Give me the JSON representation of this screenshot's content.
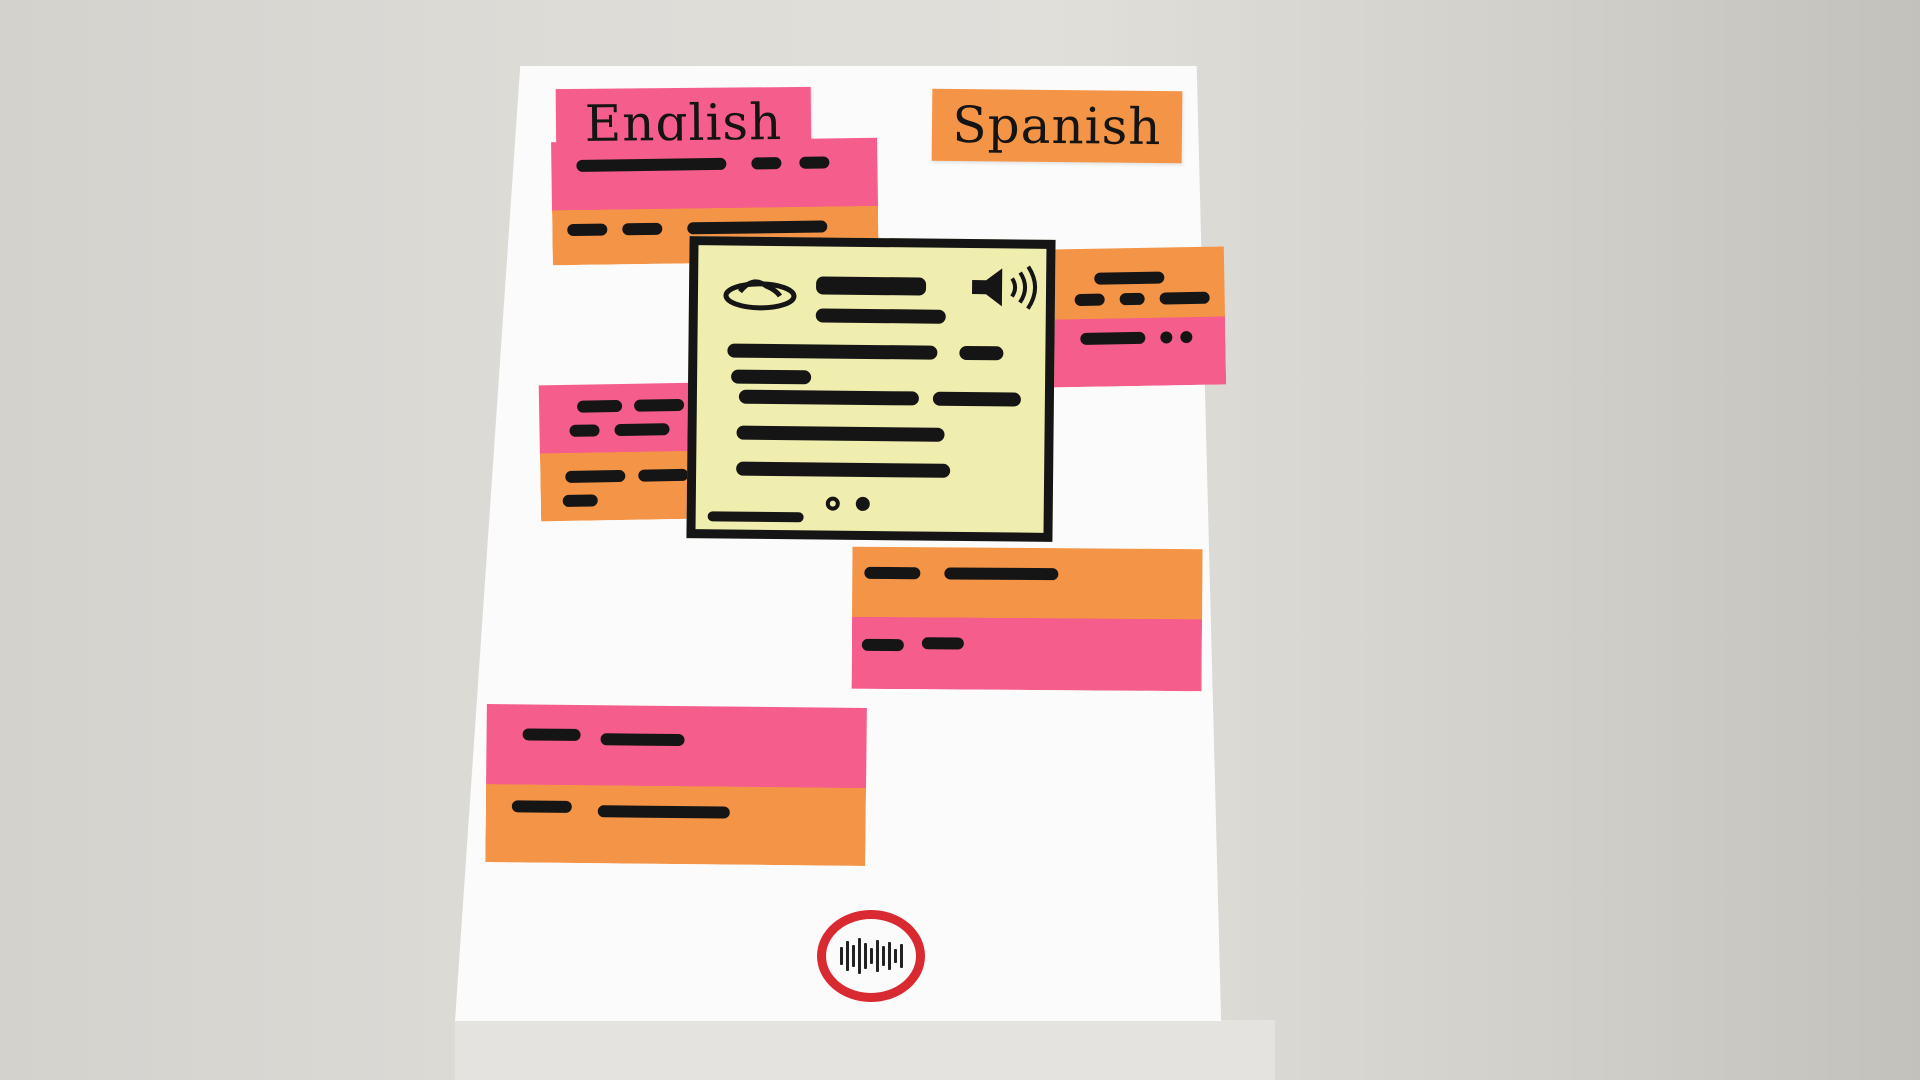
{
  "labels": {
    "source_language": "English",
    "target_language": "Spanish"
  },
  "icons": {
    "dictionary_card_left": "dish-icon",
    "dictionary_card_right": "speaker-icon",
    "record_button": "waveform-icon"
  },
  "colors": {
    "pink_note": "#f55e8c",
    "orange_note": "#f49446",
    "card_background": "#efeeae",
    "record_ring": "#d82a30"
  }
}
